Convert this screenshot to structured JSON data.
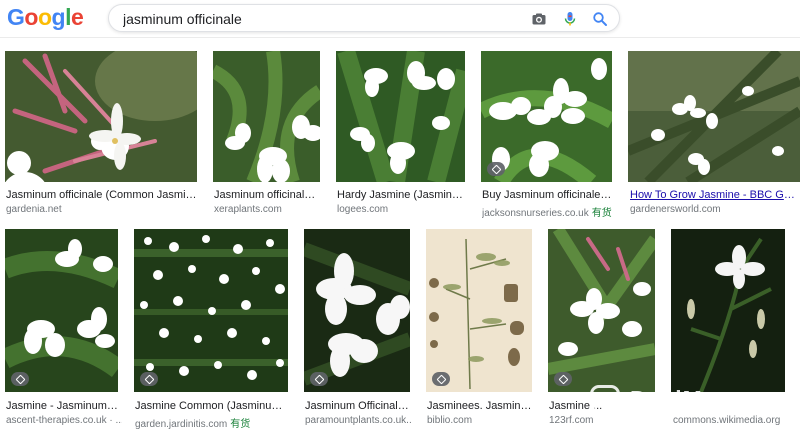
{
  "header": {
    "logo_letters": [
      "G",
      "o",
      "o",
      "g",
      "l",
      "e"
    ],
    "search_value": "jasminum officinale",
    "icons": [
      "camera-icon",
      "microphone-icon",
      "search-icon"
    ]
  },
  "colors": {
    "blue": "#4285f4",
    "red": "#ea4335",
    "yellow": "#fbbc05",
    "green": "#34a853",
    "leaf_dark": "#1f3a1a",
    "leaf": "#3f6b2e",
    "flower": "#ffffff",
    "bud_pink": "#b84a6a"
  },
  "results": [
    {
      "caption": "Jasminum officinale (Common Jasmine)",
      "source": "gardenia.net",
      "in_stock": ""
    },
    {
      "caption": "Jasminum officinale 'G...",
      "source": "xeraplants.com",
      "in_stock": ""
    },
    {
      "caption": "Hardy Jasmine (Jasminum O...",
      "source": "logees.com",
      "in_stock": ""
    },
    {
      "caption": "Buy Jasminum officinale (Co...",
      "source": "jacksonsnurseries.co.uk",
      "in_stock": "有货"
    },
    {
      "caption": "How To Grow Jasmine - BBC Gardener...",
      "source": "gardenersworld.com",
      "in_stock": ""
    },
    {
      "caption": "Jasmine - Jasminum Offi...",
      "source": "ascent-therapies.co.uk · ...",
      "in_stock": ""
    },
    {
      "caption": "Jasmine Common (Jasminum Offi...",
      "source": "garden.jardinitis.com",
      "in_stock": "有货"
    },
    {
      "caption": "Jasminum Officinale or...",
      "source": "paramountplants.co.uk...",
      "in_stock": ""
    },
    {
      "caption": "Jasminees. Jasminum ...",
      "source": "biblio.com",
      "in_stock": ""
    },
    {
      "caption": "Jasmine ...",
      "source": "123rf.com",
      "in_stock": ""
    },
    {
      "caption": "",
      "source": "commons.wikimedia.org",
      "in_stock": ""
    }
  ],
  "watermark": "DealMoon"
}
